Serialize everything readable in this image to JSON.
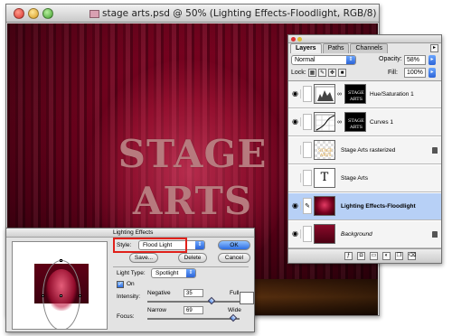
{
  "document": {
    "title": "stage arts.psd @ 50% (Lighting Effects-Floodlight, RGB/8)",
    "text_line1": "STAGE",
    "text_line2": "ARTS"
  },
  "layers_panel": {
    "tabs": [
      "Layers",
      "Paths",
      "Channels"
    ],
    "blend_mode": "Normal",
    "opacity_label": "Opacity:",
    "opacity_value": "58%",
    "lock_label": "Lock:",
    "fill_label": "Fill:",
    "fill_value": "100%",
    "layers": [
      {
        "name": "Hue/Saturation 1",
        "visible": true,
        "selected": false
      },
      {
        "name": "Curves 1",
        "visible": true,
        "selected": false
      },
      {
        "name": "Stage Arts rasterized",
        "visible": false,
        "selected": false
      },
      {
        "name": "Stage Arts",
        "visible": false,
        "selected": false
      },
      {
        "name": "Lighting Effects-Floodlight",
        "visible": true,
        "selected": true
      },
      {
        "name": "Background",
        "visible": true,
        "selected": false
      }
    ],
    "text_layer_glyph": "T"
  },
  "lighting_dialog": {
    "title": "Lighting Effects",
    "style_label": "Style:",
    "style_value": "Flood Light",
    "ok_label": "OK",
    "cancel_label": "Cancel",
    "save_label": "Save...",
    "delete_label": "Delete",
    "light_type_label": "Light Type:",
    "light_type_value": "Spotlight",
    "on_label": "On",
    "intensity_label": "Intensity:",
    "negative_label": "Negative",
    "full_label": "Full",
    "intensity_value": "35",
    "focus_label": "Focus:",
    "narrow_label": "Narrow",
    "wide_label": "Wide",
    "focus_value": "69"
  },
  "colors": {
    "curtain": "#6a0019",
    "highlight": "#e0201a",
    "selected_layer": "#b7d0f6"
  }
}
